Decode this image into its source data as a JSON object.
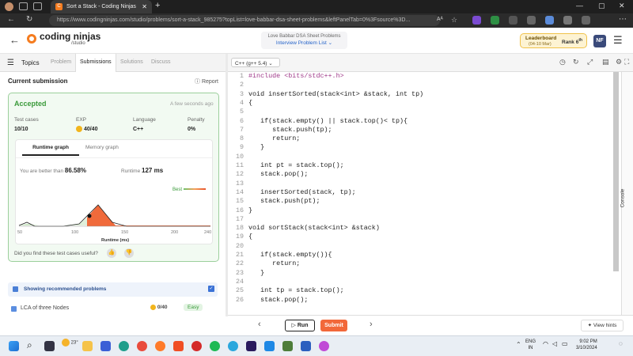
{
  "browser": {
    "tab_title": "Sort a Stack - Coding Ninjas",
    "url": "https://www.codingninjas.com/studio/problems/sort-a-stack_985275?topList=love-babbar-dsa-sheet-problems&leftPanelTab=0%3Fsource%3D...",
    "reader_label": "Aᴬ"
  },
  "header": {
    "logo_text": "coding ninjas",
    "logo_sub": "/studio",
    "sheet_title": "Love Babbar DSA Sheet Problems",
    "sheet_link": "Interview Problem List",
    "leaderboard_label": "Leaderboard",
    "leaderboard_dates": "(04-10 Mar)",
    "rank_label": "Rank",
    "rank_value": "6",
    "rank_suffix": "th",
    "avatar": "NF"
  },
  "left_tabs": {
    "topics": "Topics",
    "problem": "Problem",
    "submissions": "Submissions",
    "solutions": "Solutions",
    "discuss": "Discuss"
  },
  "submission": {
    "heading": "Current submission",
    "report": "Report",
    "status": "Accepted",
    "time": "A few seconds ago",
    "labels": {
      "tests": "Test cases",
      "exp": "EXP",
      "lang": "Language",
      "penalty": "Penalty"
    },
    "values": {
      "tests": "10/10",
      "exp": "40/40",
      "lang": "C++",
      "penalty": "0%"
    },
    "graph_tabs": {
      "runtime": "Runtime graph",
      "memory": "Memory graph"
    },
    "better_label": "You are better than",
    "better_value": "86.58%",
    "runtime_label": "Runtime",
    "runtime_value": "127 ms",
    "best_label": "Best",
    "x_ticks": [
      "50",
      "100",
      "150",
      "200",
      "240"
    ],
    "x_label": "Runtime (ms)",
    "feedback": "Did you find these test cases useful?"
  },
  "recommended": {
    "label": "Showing recommended problems",
    "item_title": "LCA of three Nodes",
    "item_exp": "0/40",
    "item_level": "Easy"
  },
  "editor": {
    "language": "C++ (g++ 5.4)",
    "lines": [
      "#include <bits/stdc++.h>",
      "",
      "void insertSorted(stack<int> &stack, int tp)",
      "{",
      "",
      "   if(stack.empty() || stack.top()< tp){",
      "      stack.push(tp);",
      "      return;",
      "   }",
      "",
      "   int pt = stack.top();",
      "   stack.pop();",
      "",
      "   insertSorted(stack, tp);",
      "   stack.push(pt);",
      "}",
      "",
      "void sortStack(stack<int> &stack)",
      "{",
      "",
      "   if(stack.empty()){",
      "      return;",
      "   }",
      "",
      "   int tp = stack.top();",
      "   stack.pop();"
    ],
    "console_label": "Console"
  },
  "actions": {
    "run": "Run",
    "submit": "Submit",
    "view_hints": "View hints"
  },
  "taskbar": {
    "weather": "23°",
    "lang1": "ENG",
    "lang2": "IN",
    "time": "9:02 PM",
    "date": "3/10/2024"
  },
  "colors": {
    "accent": "#f57c1f",
    "accepted_green": "#3a9a3a",
    "link_blue": "#2563c9"
  }
}
